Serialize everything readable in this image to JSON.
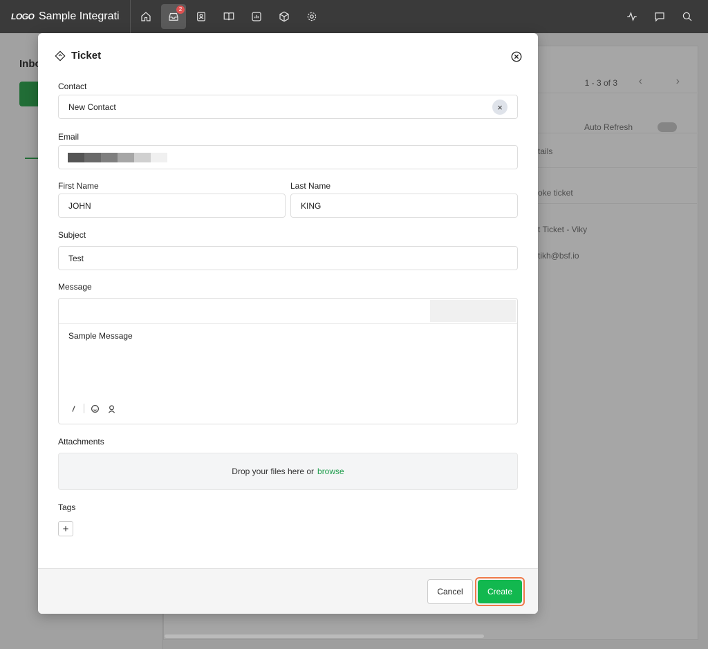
{
  "app": {
    "logo": "LOGO",
    "title": "Sample Integrati..."
  },
  "nav": {
    "inbox_badge": "2"
  },
  "background": {
    "inbox_title": "Inbo",
    "pager": "1 - 3 of 3",
    "auto_refresh": "Auto Refresh",
    "details": "tails",
    "row1": "oke ticket",
    "row2": "t Ticket - Viky",
    "row3": "tikh@bsf.io"
  },
  "modal": {
    "title": "Ticket",
    "contact": {
      "label": "Contact",
      "value": "New Contact",
      "clear": "×"
    },
    "email": {
      "label": "Email",
      "redaction_colors": [
        "#555555",
        "#6a6a6a",
        "#7f7f7f",
        "#a6a6a6",
        "#d0d0d0",
        "#f0f0f0"
      ]
    },
    "first_name": {
      "label": "First Name",
      "value": "JOHN"
    },
    "last_name": {
      "label": "Last Name",
      "value": "KING"
    },
    "subject": {
      "label": "Subject",
      "value": "Test"
    },
    "message": {
      "label": "Message",
      "value": "Sample Message"
    },
    "attachments": {
      "label": "Attachments",
      "drop_text": "Drop your files here or",
      "browse": "browse"
    },
    "tags": {
      "label": "Tags",
      "add": "+"
    },
    "cancel": "Cancel",
    "create": "Create"
  },
  "colors": {
    "primary": "#12b84f",
    "highlight": "#f07a4a",
    "topbar": "#3a3a3a"
  }
}
